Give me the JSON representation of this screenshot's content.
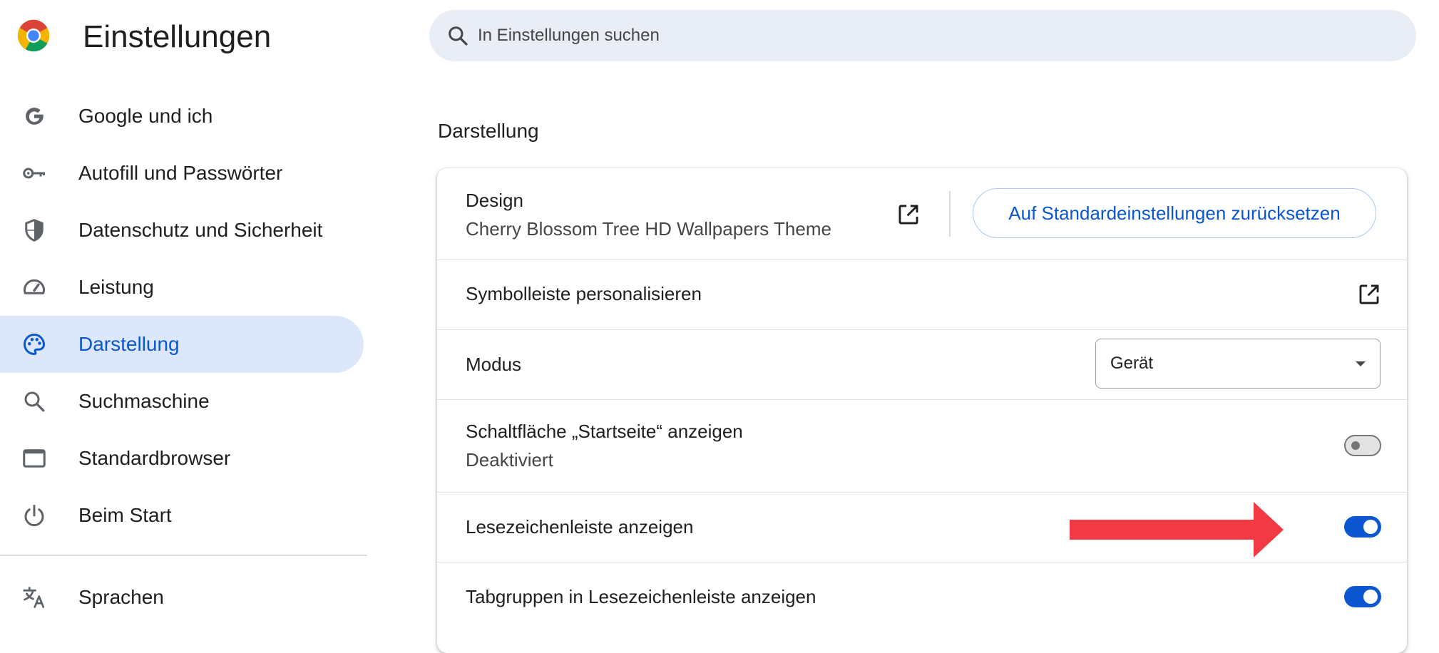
{
  "header": {
    "app_title": "Einstellungen",
    "logo_icon": "chrome-logo-icon"
  },
  "search": {
    "placeholder": "In Einstellungen suchen",
    "icon": "search-icon"
  },
  "sidebar": {
    "items": [
      {
        "label": "Google und ich",
        "icon": "google-g-icon",
        "active": false
      },
      {
        "label": "Autofill und Passwörter",
        "icon": "key-icon",
        "active": false
      },
      {
        "label": "Datenschutz und Sicherheit",
        "icon": "shield-icon",
        "active": false
      },
      {
        "label": "Leistung",
        "icon": "speedometer-icon",
        "active": false
      },
      {
        "label": "Darstellung",
        "icon": "palette-icon",
        "active": true
      },
      {
        "label": "Suchmaschine",
        "icon": "search-icon",
        "active": false
      },
      {
        "label": "Standardbrowser",
        "icon": "browser-window-icon",
        "active": false
      },
      {
        "label": "Beim Start",
        "icon": "power-icon",
        "active": false
      },
      {
        "label": "Sprachen",
        "icon": "translate-icon",
        "active": false
      }
    ]
  },
  "main": {
    "section_title": "Darstellung",
    "design": {
      "title": "Design",
      "value": "Cherry Blossom Tree HD Wallpapers Theme",
      "reset_label": "Auf Standardeinstellungen zurücksetzen"
    },
    "toolbar_row": {
      "title": "Symbolleiste personalisieren"
    },
    "mode_row": {
      "title": "Modus",
      "selected": "Gerät"
    },
    "home_row": {
      "title": "Schaltfläche „Startseite“ anzeigen",
      "status": "Deaktiviert",
      "enabled": false
    },
    "bookmarks_row": {
      "title": "Lesezeichenleiste anzeigen",
      "enabled": true
    },
    "tabgroups_row": {
      "title": "Tabgruppen in Lesezeichenleiste anzeigen",
      "enabled": true
    }
  },
  "annotation": {
    "arrow_icon": "red-arrow-right-icon",
    "color": "#f23a45"
  },
  "colors": {
    "accent": "#0b57d0",
    "active_nav_bg": "#dde7fb",
    "search_bg": "#e9edf6"
  }
}
